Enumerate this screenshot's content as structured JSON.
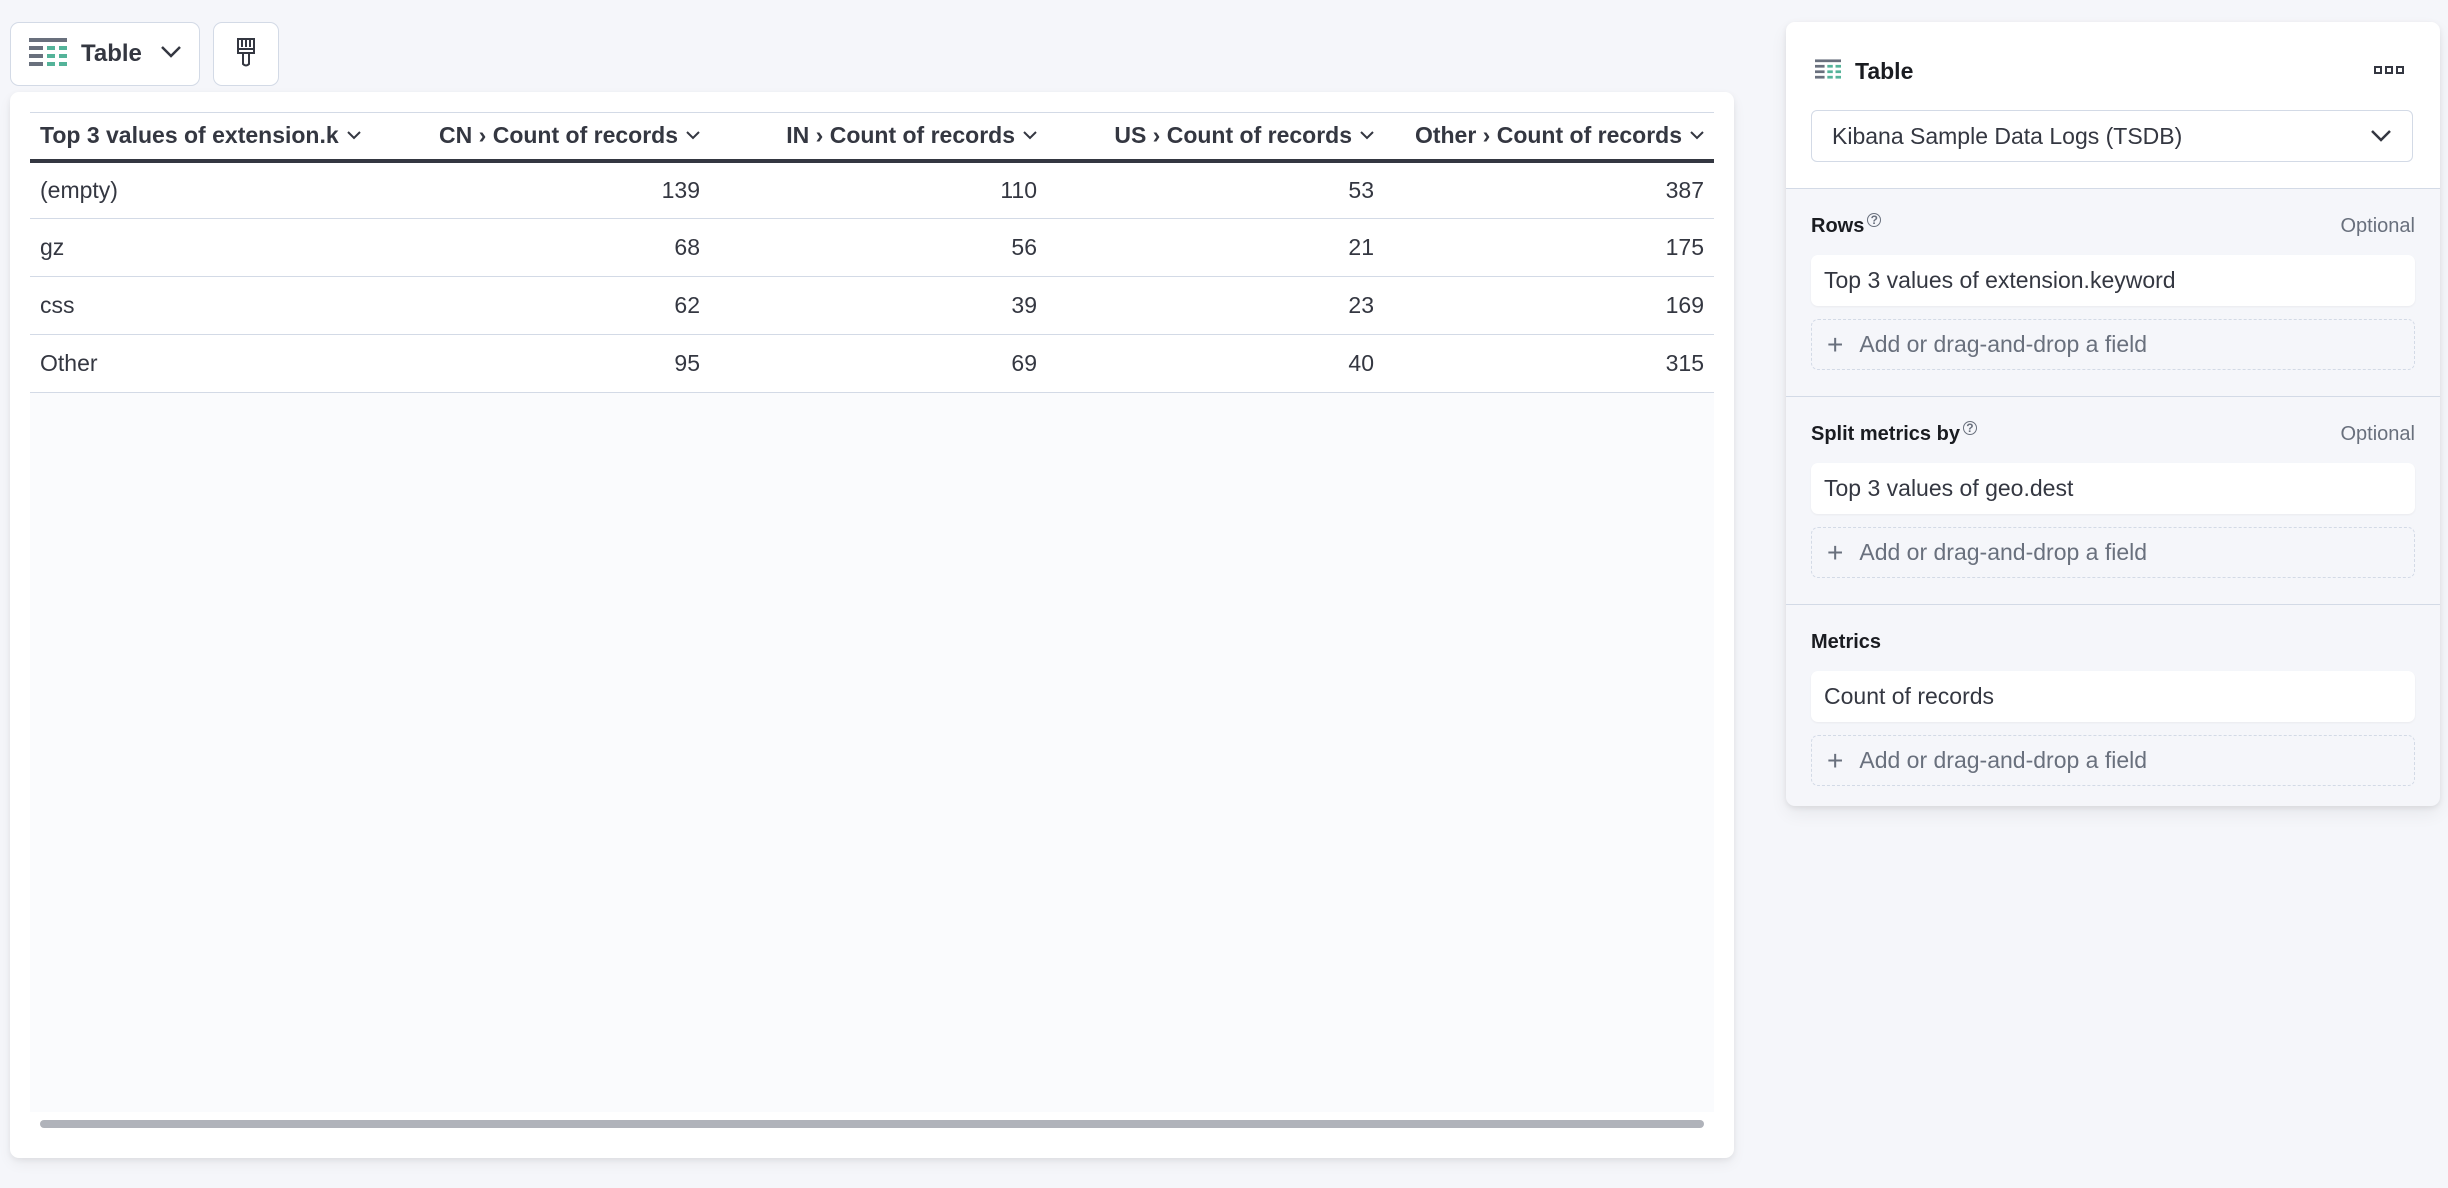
{
  "toolbar": {
    "chart_type_label": "Table",
    "chart_type_icon": "table-icon",
    "chevron_icon": "chevron-down-icon",
    "style_button_icon": "paintbrush-icon"
  },
  "table": {
    "columns": [
      "Top 3 values of extension.k",
      "CN › Count of records",
      "IN › Count of records",
      "US › Count of records",
      "Other › Count of records"
    ],
    "rows": [
      [
        "(empty)",
        "139",
        "110",
        "53",
        "387"
      ],
      [
        "gz",
        "68",
        "56",
        "21",
        "175"
      ],
      [
        "css",
        "62",
        "39",
        "23",
        "169"
      ],
      [
        "Other",
        "95",
        "69",
        "40",
        "315"
      ]
    ]
  },
  "panel": {
    "title": "Table",
    "title_icon": "table-icon",
    "more_icon": "more-options-icon",
    "data_view": "Kibana Sample Data Logs (TSDB)",
    "sections": [
      {
        "label": "Rows",
        "optional": "Optional",
        "has_help": true,
        "items": [
          "Top 3 values of extension.keyword"
        ],
        "add_label": "Add or drag-and-drop a field"
      },
      {
        "label": "Split metrics by",
        "optional": "Optional",
        "has_help": true,
        "items": [
          "Top 3 values of geo.dest"
        ],
        "add_label": "Add or drag-and-drop a field"
      },
      {
        "label": "Metrics",
        "optional": "",
        "has_help": false,
        "items": [
          "Count of records"
        ],
        "add_label": "Add or drag-and-drop a field"
      }
    ]
  },
  "colors": {
    "accent_green": "#54b399",
    "text": "#343741",
    "muted": "#69707d",
    "border": "#d3dae6"
  }
}
